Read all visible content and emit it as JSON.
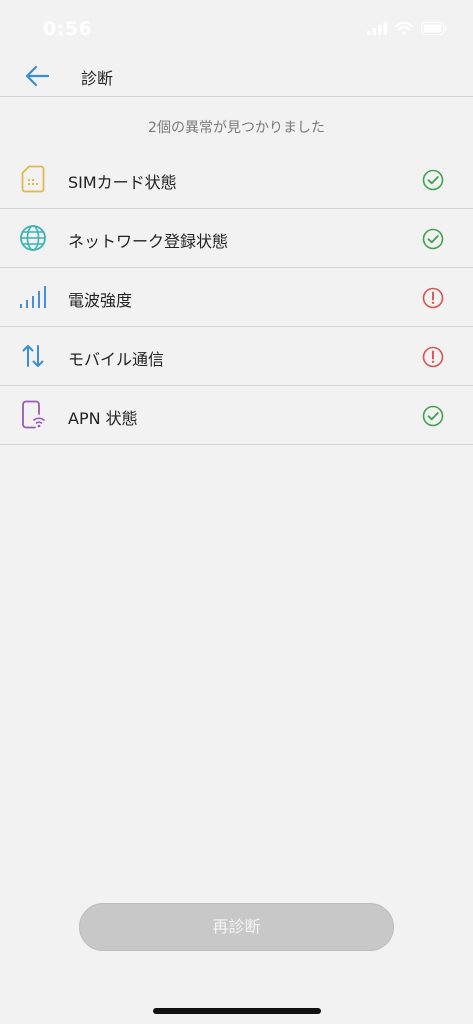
{
  "status_bar": {
    "time": "0:56"
  },
  "header": {
    "title": "診断"
  },
  "summary": "2個の異常が見つかりました",
  "items": [
    {
      "label": "SIMカード状態",
      "icon": "sim-card-icon",
      "status": "ok"
    },
    {
      "label": "ネットワーク登録状態",
      "icon": "globe-icon",
      "status": "ok"
    },
    {
      "label": "電波強度",
      "icon": "signal-bars-icon",
      "status": "error"
    },
    {
      "label": "モバイル通信",
      "icon": "data-transfer-icon",
      "status": "error"
    },
    {
      "label": "APN 状態",
      "icon": "phone-wifi-icon",
      "status": "ok"
    }
  ],
  "rescan_label": "再診断",
  "colors": {
    "ok": "#3fa34d",
    "error": "#d9534f",
    "sim": "#e0b94a",
    "globe": "#3bb3b8",
    "signal": "#4a90d9",
    "transfer": "#3a8fd6",
    "apn": "#9b59b6",
    "back": "#3a8fd6",
    "disabled_button": "#c8c8c8"
  }
}
